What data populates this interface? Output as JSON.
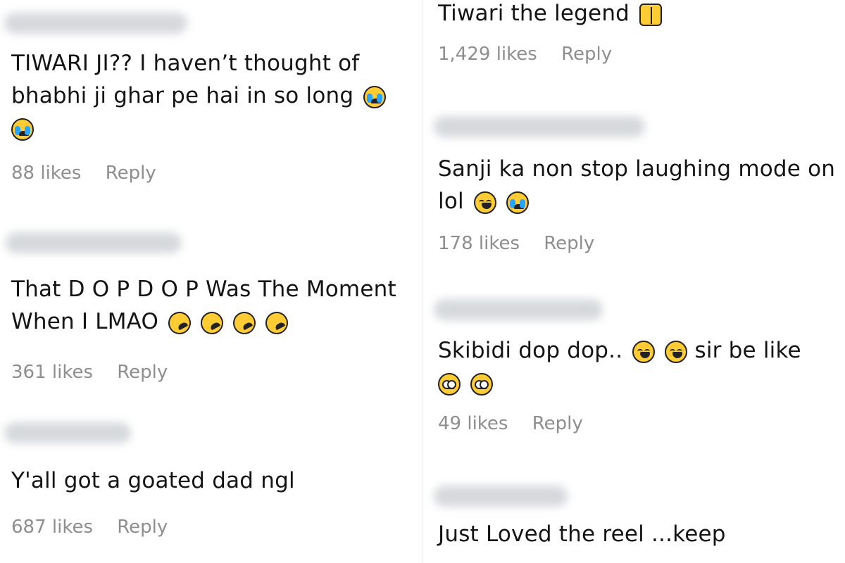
{
  "left_column": [
    {
      "text_lines": [
        "TIWARI JI?? I haven’t thought of",
        "bhabhi ji ghar pe hai in so long"
      ],
      "extra_line": "",
      "likes": "88 likes",
      "reply": "Reply"
    },
    {
      "text_lines": [
        "That D O P D O P Was The Moment",
        "When I LMAO"
      ],
      "likes": "361 likes",
      "reply": "Reply"
    },
    {
      "text_lines": [
        "Y'all got a goated dad ngl"
      ],
      "likes": "687 likes",
      "reply": "Reply"
    }
  ],
  "right_column": [
    {
      "text_lines": [
        "Tiwari the legend"
      ],
      "likes": "1,429 likes",
      "reply": "Reply"
    },
    {
      "text_lines": [
        "Sanji ka non stop laughing mode on",
        "lol"
      ],
      "likes": "178 likes",
      "reply": "Reply"
    },
    {
      "text_lines": [
        "Skibidi dop dop..",
        "sir be like"
      ],
      "likes": "49 likes",
      "reply": "Reply"
    },
    {
      "text_lines": [
        "Just Loved the reel ...keep"
      ],
      "likes": "",
      "reply": ""
    }
  ],
  "emoji_names": [
    "loudly-crying-face",
    "rolling-on-floor-laughing",
    "face-with-tears-of-joy",
    "face-with-rolling-eyes",
    "folded-hands"
  ]
}
